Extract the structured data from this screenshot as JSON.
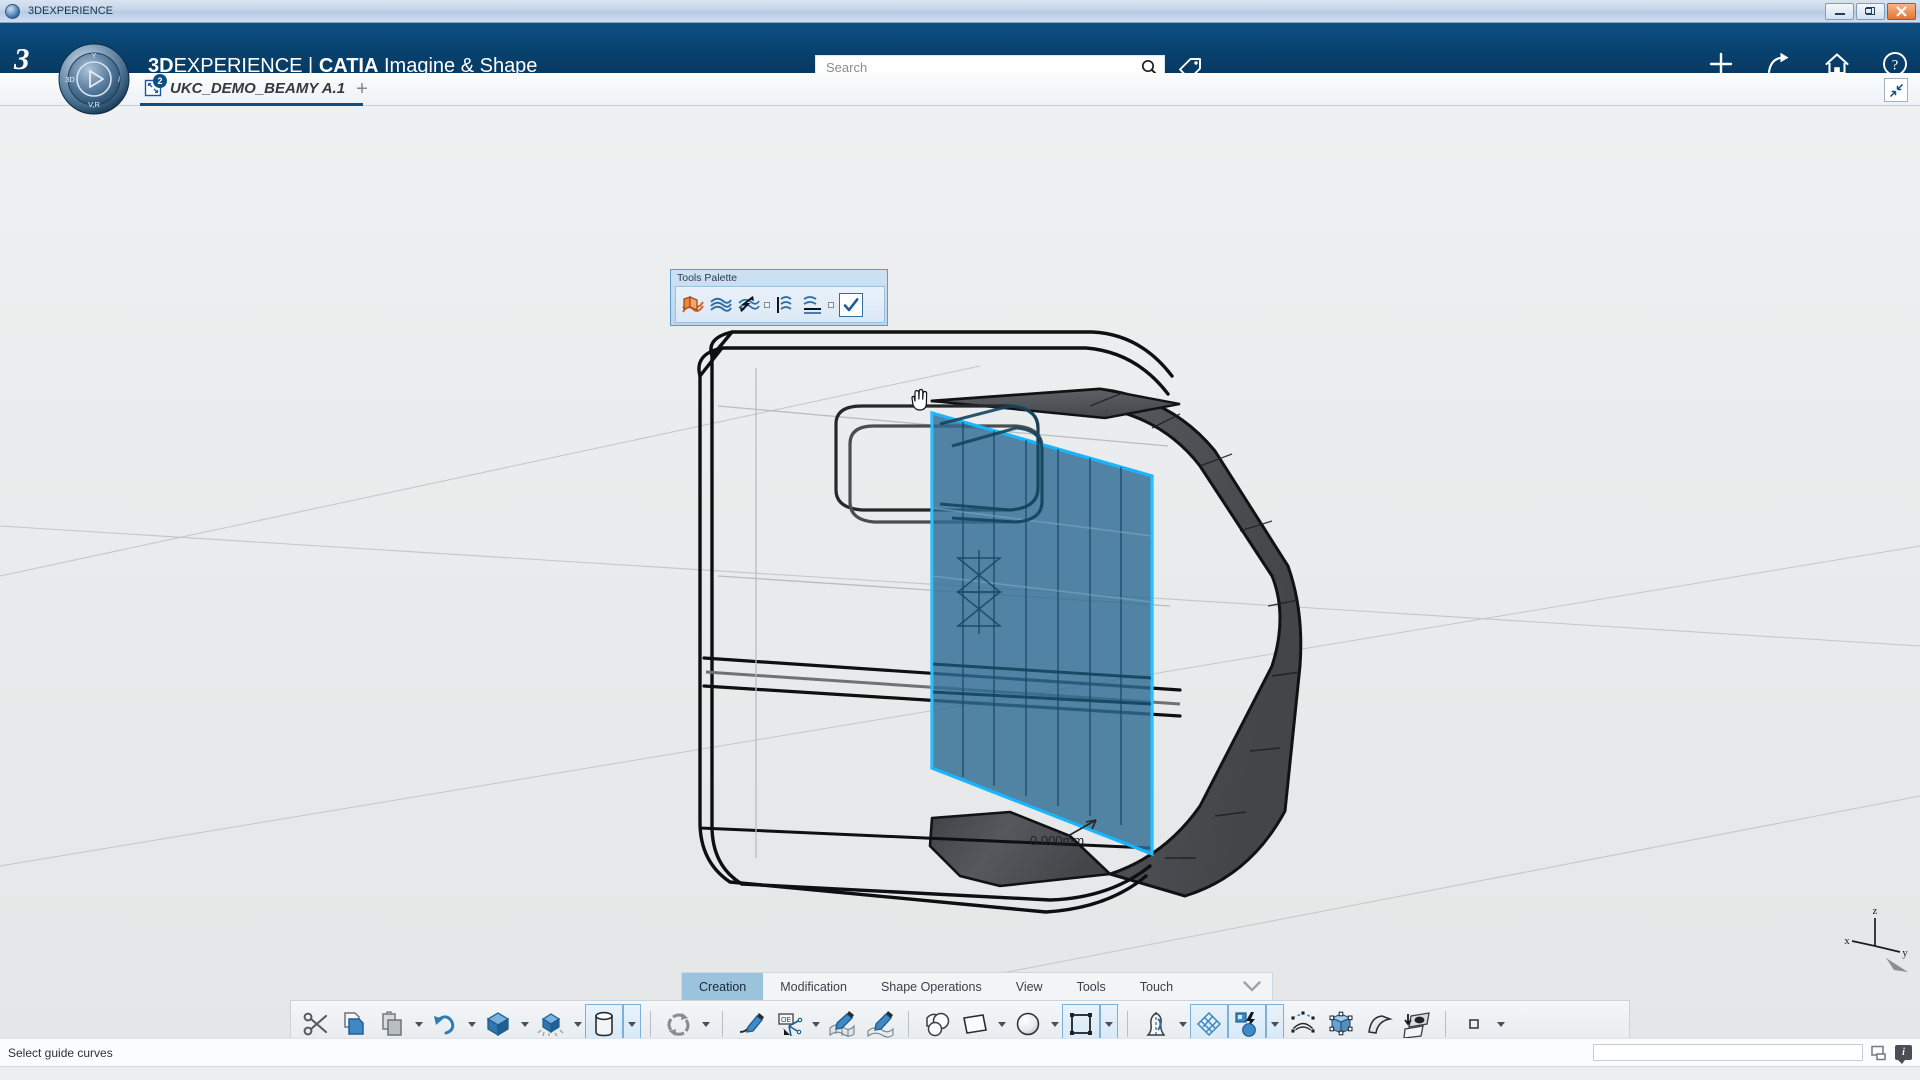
{
  "os_window": {
    "title": "3DEXPERIENCE",
    "app_icon": "3ds-app-icon",
    "buttons": [
      {
        "name": "minimize-button",
        "icon": "minimize-icon",
        "label": ""
      },
      {
        "name": "restore-button",
        "icon": "restore-icon",
        "label": ""
      },
      {
        "name": "close-button",
        "icon": "close-icon",
        "label": ""
      }
    ]
  },
  "topbar": {
    "logo": "3ds-logo",
    "compass": {
      "name": "3d-compass",
      "labels": {
        "top": "Y",
        "left": "3D",
        "right": "i",
        "bottom": "V,R"
      },
      "center_icon": "play-icon"
    },
    "brand_bold": "3D",
    "brand_rest": "EXPERIENCE | ",
    "brand_app_bold": "CATIA",
    "brand_app_rest": " Imagine & Shape",
    "search": {
      "placeholder": "Search",
      "value": "",
      "icon": "search-icon"
    },
    "tag_icon": "tag-icon",
    "actions": [
      {
        "name": "add-button",
        "icon": "plus-icon"
      },
      {
        "name": "share-button",
        "icon": "share-arrow-icon"
      },
      {
        "name": "home-button",
        "icon": "home-icon"
      },
      {
        "name": "help-button",
        "icon": "question-circle-icon"
      }
    ]
  },
  "tabstrip": {
    "document_tab": {
      "title": "UKC_DEMO_BEAMY A.1",
      "badge": "2",
      "icon": "expand-frame-icon"
    },
    "new_tab_label": "+",
    "collapse_icon": "collapse-diagonal-icon"
  },
  "tools_palette": {
    "title": "Tools Palette",
    "items": [
      {
        "name": "tool-surface-highlighted",
        "icon": "surface-patch-orange-icon",
        "active": true
      },
      {
        "name": "tool-multi-surface",
        "icon": "stacked-surfaces-icon",
        "active": false
      },
      {
        "name": "tool-surface-arrows",
        "icon": "surface-flip-arrows-icon",
        "active": false
      },
      {
        "name": "tool-surface-ruled",
        "icon": "ruled-surface-icon",
        "active": false
      },
      {
        "name": "tool-surface-sweep",
        "icon": "swept-surface-icon",
        "active": false
      },
      {
        "name": "tool-confirm",
        "icon": "checkbox-checked-icon",
        "active": false
      }
    ]
  },
  "viewport": {
    "dimension_label": "0.000mm",
    "cursor": "hand-cursor",
    "triad": {
      "x": "x",
      "y": "y",
      "z": "z"
    }
  },
  "action_tabs": {
    "tabs": [
      {
        "label": "Creation",
        "selected": true
      },
      {
        "label": "Modification",
        "selected": false
      },
      {
        "label": "Shape Operations",
        "selected": false
      },
      {
        "label": "View",
        "selected": false
      },
      {
        "label": "Tools",
        "selected": false
      },
      {
        "label": "Touch",
        "selected": false
      }
    ],
    "chevron_icon": "chevron-down-icon"
  },
  "action_bar": {
    "groups": [
      {
        "items": [
          {
            "name": "cut-button",
            "icon": "scissors-icon",
            "caret": false,
            "highlighted": false
          },
          {
            "name": "copy-button",
            "icon": "copy-pages-icon",
            "caret": false,
            "highlighted": false
          },
          {
            "name": "paste-button",
            "icon": "paste-clipboard-icon",
            "caret": true,
            "highlighted": false
          },
          {
            "name": "undo-button",
            "icon": "undo-arrow-icon",
            "caret": true,
            "highlighted": false
          },
          {
            "name": "create-solid-button",
            "icon": "blue-cube-icon",
            "caret": true,
            "highlighted": false
          },
          {
            "name": "subdivide-button",
            "icon": "cube-sparkle-icon",
            "caret": true,
            "highlighted": false
          },
          {
            "name": "cylinder-button",
            "icon": "cylinder-icon",
            "caret": true,
            "highlighted": true
          }
        ]
      },
      {
        "items": [
          {
            "name": "refresh-button",
            "icon": "refresh-cycle-icon",
            "caret": true,
            "highlighted": false
          }
        ]
      },
      {
        "items": [
          {
            "name": "create-curve-button",
            "icon": "pencil-curve-icon",
            "caret": false,
            "highlighted": false
          },
          {
            "name": "sketch-button",
            "icon": "pencil-sketch-axis-icon",
            "caret": true,
            "highlighted": false
          },
          {
            "name": "curve-on-mesh-button",
            "icon": "pencil-mesh-icon",
            "caret": false,
            "highlighted": false
          },
          {
            "name": "curve-on-surface-button",
            "icon": "pencil-surface-icon",
            "caret": false,
            "highlighted": false
          }
        ]
      },
      {
        "items": [
          {
            "name": "boolean-shapes-button",
            "icon": "boolean-shapes-icon",
            "caret": false,
            "highlighted": false
          },
          {
            "name": "plane-button",
            "icon": "plane-square-icon",
            "caret": true,
            "highlighted": false
          },
          {
            "name": "sphere-button",
            "icon": "sphere-icon",
            "caret": true,
            "highlighted": false
          },
          {
            "name": "patch-button",
            "icon": "square-with-nodes-icon",
            "caret": true,
            "highlighted": true
          }
        ]
      },
      {
        "items": [
          {
            "name": "revolve-button",
            "icon": "revolve-profile-icon",
            "caret": true,
            "highlighted": false
          },
          {
            "name": "net-surface-button",
            "icon": "grid-net-icon",
            "caret": false,
            "highlighted": true
          },
          {
            "name": "style-button",
            "icon": "lightning-sphere-icon",
            "caret": true,
            "highlighted": true
          },
          {
            "name": "arched-surface-button",
            "icon": "arched-surface-nodes-icon",
            "caret": false,
            "highlighted": false
          },
          {
            "name": "box-nodes-button",
            "icon": "box-with-nodes-icon",
            "caret": false,
            "highlighted": false
          },
          {
            "name": "curved-sheet-button",
            "icon": "curved-sheet-icon",
            "caret": false,
            "highlighted": false
          },
          {
            "name": "project-surface-button",
            "icon": "project-onto-surface-icon",
            "caret": false,
            "highlighted": false
          }
        ]
      },
      {
        "items": [
          {
            "name": "display-mode-button",
            "icon": "small-square-icon",
            "caret": true,
            "highlighted": false
          }
        ]
      }
    ]
  },
  "status_bar": {
    "message": "Select guide curves",
    "input_value": "",
    "panel_icon": "window-panel-icon",
    "info_icon": "info-badge-icon",
    "info_letter": "i"
  },
  "colors": {
    "brand_blue": "#0d4f84",
    "selection_cyan": "#19a8f0",
    "selected_surface": "#2f6c94",
    "tab_selected": "#9cc3de",
    "dark_band": "#4a4d50"
  }
}
